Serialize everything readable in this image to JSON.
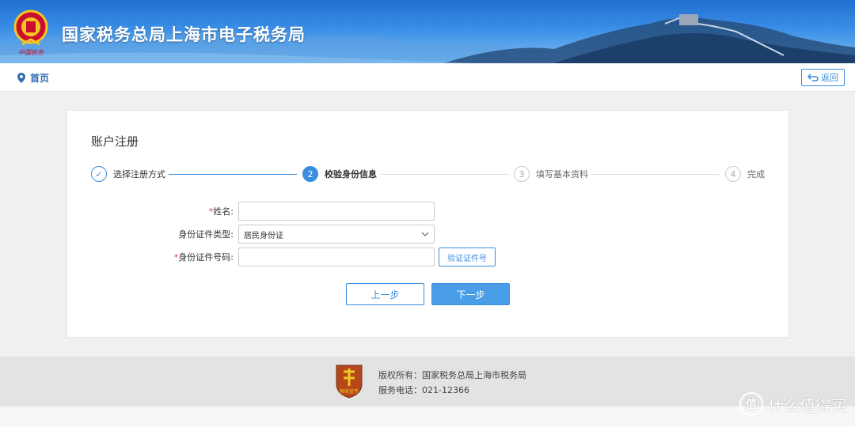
{
  "header": {
    "site_title": "国家税务总局上海市电子税务局",
    "emblem_caption": "中国税务"
  },
  "nav": {
    "home_label": "首页",
    "back_label": "返回"
  },
  "card": {
    "title": "账户注册"
  },
  "steps": [
    {
      "number": "✓",
      "label": "选择注册方式",
      "state": "done"
    },
    {
      "number": "2",
      "label": "校验身份信息",
      "state": "active"
    },
    {
      "number": "3",
      "label": "填写基本资料",
      "state": "pending"
    },
    {
      "number": "4",
      "label": "完成",
      "state": "pending"
    }
  ],
  "form": {
    "name_label": "姓名:",
    "name_required_mark": "*",
    "name_value": "",
    "id_type_label": "身份证件类型:",
    "id_type_value": "居民身份证",
    "id_number_label": "身份证件号码:",
    "id_number_required_mark": "*",
    "id_number_value": "",
    "verify_button": "验证证件号"
  },
  "buttons": {
    "prev": "上一步",
    "next": "下一步"
  },
  "footer": {
    "copyright": "版权所有：国家税务总局上海市税务局",
    "phone": "服务电话：021-12366",
    "logo_caption": "税收宣传"
  },
  "watermark": {
    "text": "什么值得买",
    "badge": "值"
  },
  "colors": {
    "accent": "#3b8de0",
    "required": "#e53e3e"
  }
}
